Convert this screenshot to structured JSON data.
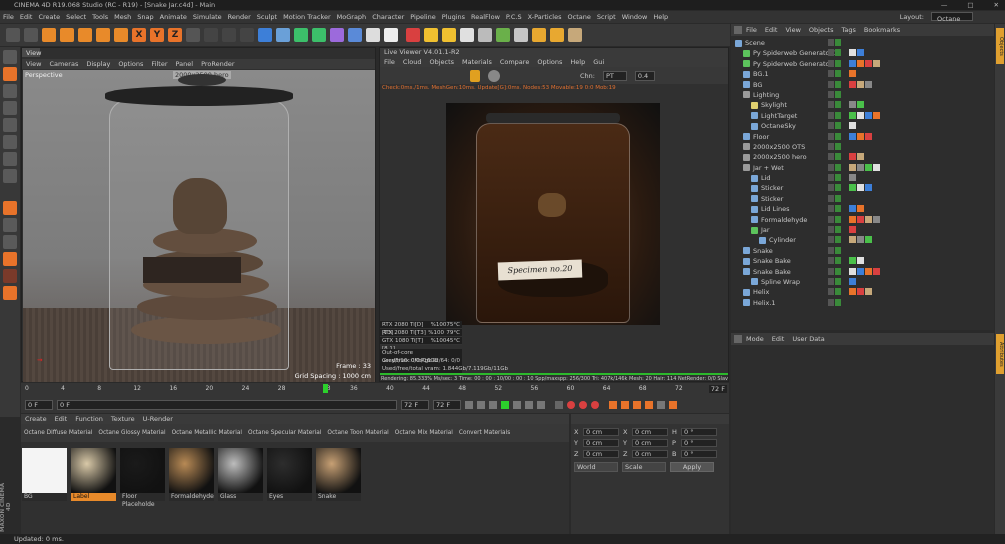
{
  "window": {
    "title": "CINEMA 4D R19.068 Studio (RC - R19) - [Snake Jar.c4d] - Main",
    "layout_label": "Layout:",
    "layout_value": "Octane (User)"
  },
  "menu": [
    "File",
    "Edit",
    "Create",
    "Select",
    "Tools",
    "Mesh",
    "Snap",
    "Animate",
    "Simulate",
    "Render",
    "Sculpt",
    "Motion Tracker",
    "MoGraph",
    "Character",
    "Pipeline",
    "Plugins",
    "RealFlow",
    "P.C.S",
    "X-Particles",
    "Octane",
    "Script",
    "Window",
    "Help"
  ],
  "toolbar": {
    "axis_x": "X",
    "axis_y": "Y",
    "axis_z": "Z"
  },
  "viewport": {
    "tab": "View",
    "menu": [
      "View",
      "Cameras",
      "Display",
      "Options",
      "Filter",
      "Panel",
      "ProRender"
    ],
    "camera_label": "Perspective",
    "resolution_tag": "2000x2500 hero",
    "frame_label": "Frame : 33",
    "grid_label": "Grid Spacing : 1000 cm"
  },
  "live_viewer": {
    "title": "Live Viewer V4.01.1-R2",
    "menu": [
      "File",
      "Cloud",
      "Objects",
      "Materials",
      "Compare",
      "Options",
      "Help",
      "Gui"
    ],
    "channel_label": "Chn:",
    "channel_value": "PT",
    "value_box": "0.4",
    "status": "Check:0ms./1ms. MeshGen:10ms. Update[G]:0ms. Nodes:53 Movable:19 0:0 Mob:19",
    "jar_label": "Specimen no.20",
    "gpus": [
      {
        "name": "RTX 2080 Ti[D][T3]",
        "pct": "%100",
        "temp": "75°C"
      },
      {
        "name": "RTX 2080 Ti[T3]",
        "pct": "%100",
        "temp": "79°C"
      },
      {
        "name": "GTX 1080 Ti[T][8.1]",
        "pct": "%100",
        "temp": "45°C"
      }
    ],
    "ooc": "Out-of-core used/max:0Kb/16Gb",
    "grey": "Grey8/16: 0/0",
    "rgb": "Rgb32/64: 0/0",
    "vram": "Used/free/total vram: 1.844Gb/7.119Gb/11Gb",
    "render_stats": "Rendering: 85.333%  Ms/sec: 3   Time: 00 : 00 : 10/00 : 00 : 10   Spp/maxspp: 256/300   Tri: 407k/146k   Mesh: 20   Hair: 114   NetRender: 0/0   Slav"
  },
  "timeline": {
    "ticks": [
      "0",
      "4",
      "8",
      "12",
      "16",
      "20",
      "24",
      "28",
      "33",
      "36",
      "40",
      "44",
      "48",
      "52",
      "56",
      "60",
      "64",
      "68",
      "72"
    ],
    "current_frame": "33",
    "end_frame_box": "72 F",
    "start_field": "0 F",
    "start_field2": "0 F",
    "end_field": "72 F",
    "end_field2": "72 F",
    "progress": 0.4583
  },
  "materials": {
    "menu": [
      "Create",
      "Edit",
      "Function",
      "Texture",
      "U-Render"
    ],
    "types": [
      "Octane Diffuse Material",
      "Octane Glossy Material",
      "Octane Metallic Material",
      "Octane Specular Material",
      "Octane Toon Material",
      "Octane Mix Material",
      "Convert Materials"
    ],
    "items": [
      {
        "name": "BG",
        "color": "#f4f4f4"
      },
      {
        "name": "Label",
        "color": "#d9c9a8"
      },
      {
        "name": "Floor Placeholde",
        "color": "#1a1a1a"
      },
      {
        "name": "Formaldehyde",
        "color": "#b88a55"
      },
      {
        "name": "Glass",
        "color": "#bdbdbd"
      },
      {
        "name": "Eyes",
        "color": "#2d2d2d"
      },
      {
        "name": "Snake",
        "color": "#c7a074"
      }
    ],
    "selected": "Label"
  },
  "coords": {
    "rows": [
      {
        "a": "X",
        "av": "0 cm",
        "b": "X",
        "bv": "0 cm",
        "c": "H",
        "cv": "0 °"
      },
      {
        "a": "Y",
        "av": "0 cm",
        "b": "Y",
        "bv": "0 cm",
        "c": "P",
        "cv": "0 °"
      },
      {
        "a": "Z",
        "av": "0 cm",
        "b": "Z",
        "bv": "0 cm",
        "c": "B",
        "cv": "0 °"
      }
    ],
    "mode1": "World",
    "mode2": "Scale",
    "apply": "Apply"
  },
  "objects": {
    "menu": [
      "File",
      "Edit",
      "View",
      "Objects",
      "Tags",
      "Bookmarks"
    ],
    "tree": [
      {
        "name": "Scene",
        "indent": 0,
        "color": "#7aa7d8"
      },
      {
        "name": "Py Spiderweb Generator.1",
        "indent": 1,
        "color": "#5cc35c"
      },
      {
        "name": "Py Spiderweb Generator",
        "indent": 1,
        "color": "#5cc35c"
      },
      {
        "name": "BG.1",
        "indent": 1,
        "color": "#7aa7d8"
      },
      {
        "name": "BG",
        "indent": 1,
        "color": "#7aa7d8"
      },
      {
        "name": "Lighting",
        "indent": 1,
        "color": "#9a9a9a"
      },
      {
        "name": "Skylight",
        "indent": 2,
        "color": "#e0d070"
      },
      {
        "name": "LightTarget",
        "indent": 2,
        "color": "#7aa7d8"
      },
      {
        "name": "OctaneSky",
        "indent": 2,
        "color": "#7aa7d8"
      },
      {
        "name": "Floor",
        "indent": 1,
        "color": "#7aa7d8"
      },
      {
        "name": "2000x2500 OTS",
        "indent": 1,
        "color": "#9a9a9a"
      },
      {
        "name": "2000x2500 hero",
        "indent": 1,
        "color": "#9a9a9a"
      },
      {
        "name": "Jar + Wet",
        "indent": 1,
        "color": "#9a9a9a"
      },
      {
        "name": "Lid",
        "indent": 2,
        "color": "#7aa7d8"
      },
      {
        "name": "Sticker",
        "indent": 2,
        "color": "#7aa7d8"
      },
      {
        "name": "Sticker",
        "indent": 2,
        "color": "#7aa7d8"
      },
      {
        "name": "Lid Lines",
        "indent": 2,
        "color": "#7aa7d8"
      },
      {
        "name": "Formaldehyde",
        "indent": 2,
        "color": "#7aa7d8"
      },
      {
        "name": "Jar",
        "indent": 2,
        "color": "#5cc35c"
      },
      {
        "name": "Cylinder",
        "indent": 3,
        "color": "#7aa7d8"
      },
      {
        "name": "Snake",
        "indent": 1,
        "color": "#7aa7d8"
      },
      {
        "name": "Snake Bake",
        "indent": 1,
        "color": "#7aa7d8"
      },
      {
        "name": "Snake Bake",
        "indent": 1,
        "color": "#7aa7d8"
      },
      {
        "name": "Spline Wrap",
        "indent": 2,
        "color": "#7aa7d8"
      },
      {
        "name": "Helix",
        "indent": 1,
        "color": "#7aa7d8"
      },
      {
        "name": "Helix.1",
        "indent": 1,
        "color": "#7aa7d8"
      }
    ]
  },
  "attributes": {
    "menu": [
      "Mode",
      "Edit",
      "User Data"
    ]
  },
  "right_tabs": [
    "Objects",
    "Attributes"
  ],
  "status": "Updated: 0 ms.",
  "logo": "MAXON CINEMA 4D"
}
